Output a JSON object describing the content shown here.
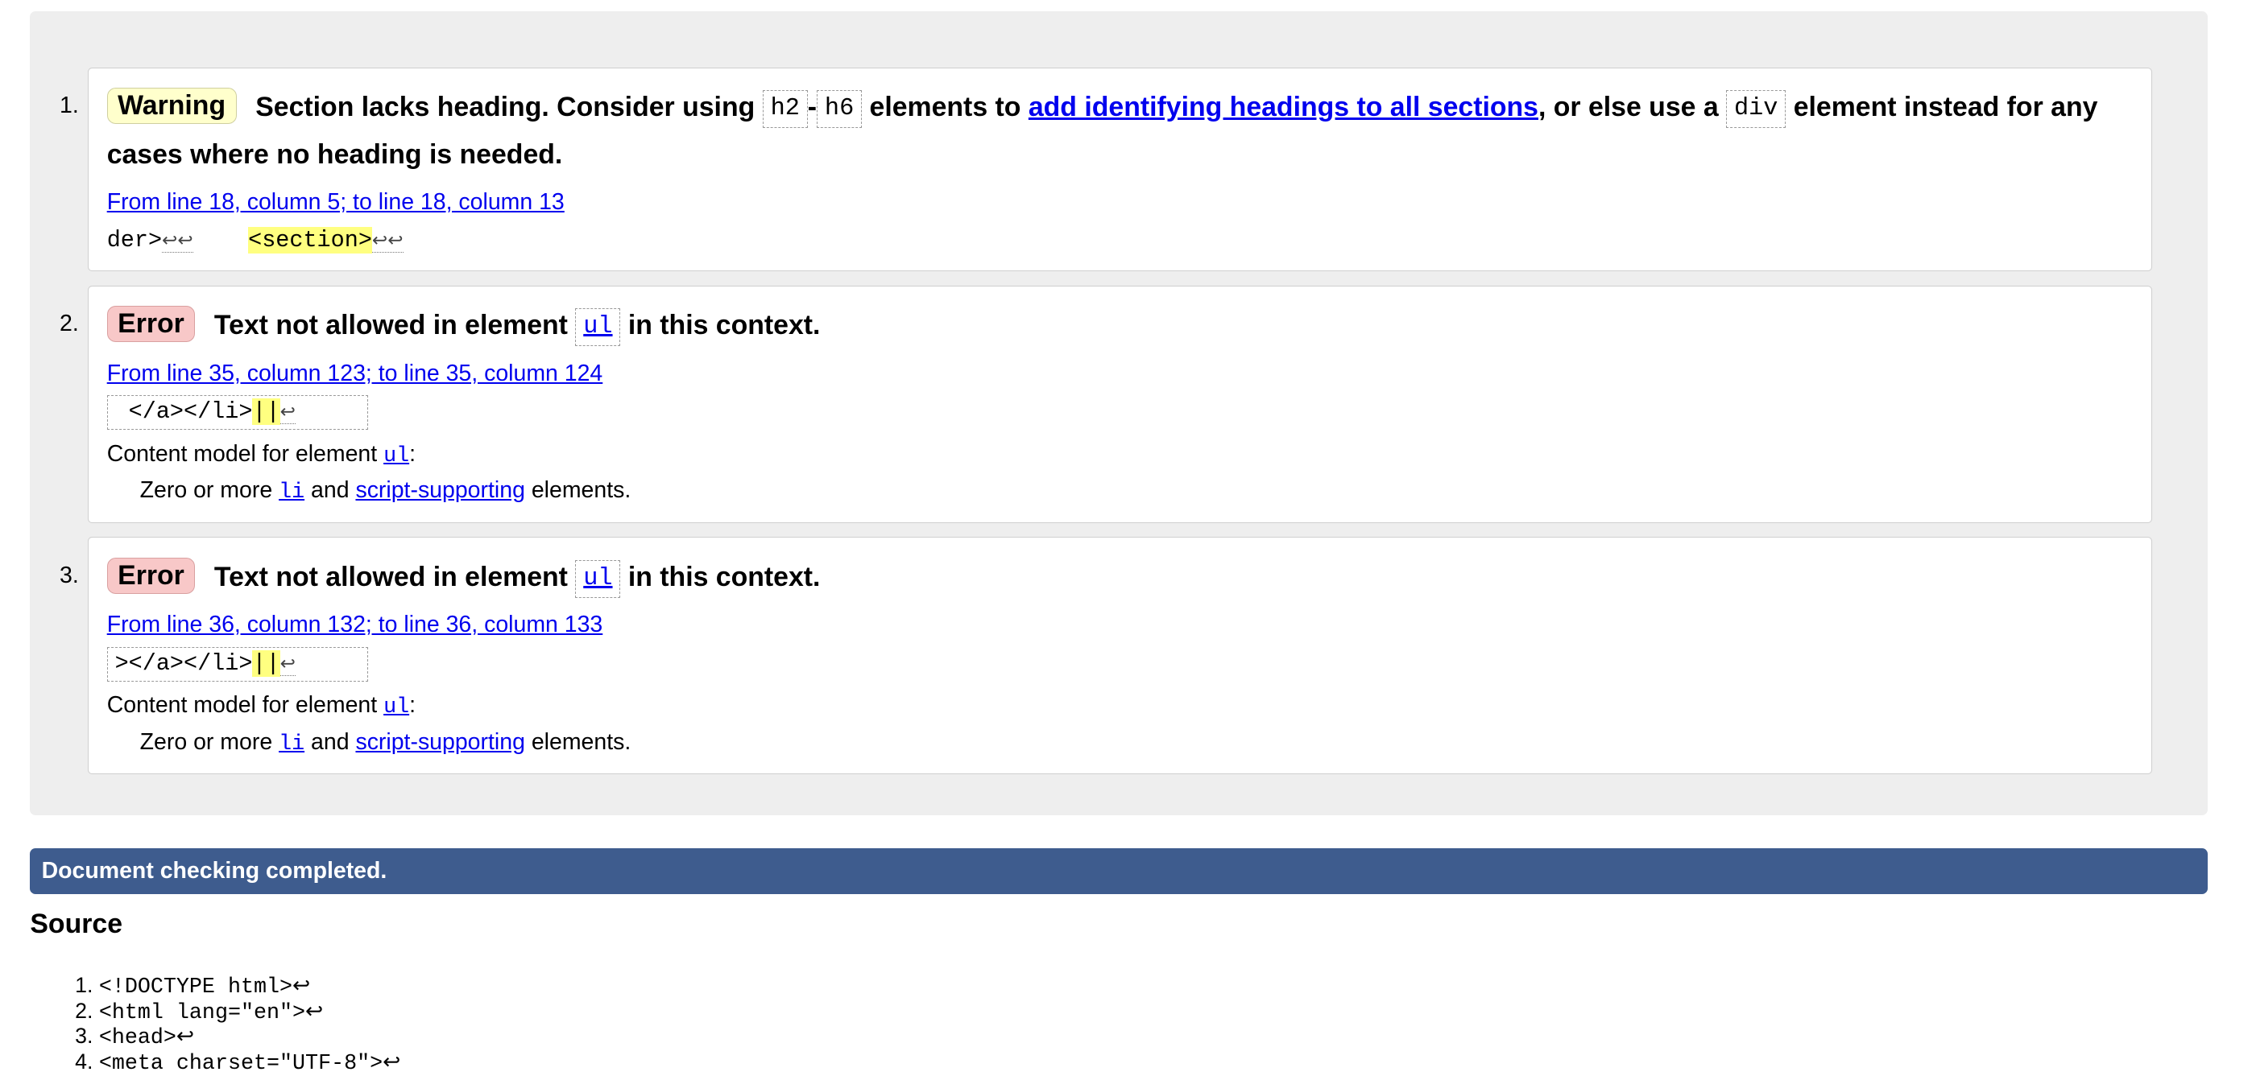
{
  "messages": [
    {
      "badge": "Warning",
      "text_1": "Section lacks heading. Consider using",
      "code_1": "h2",
      "dash": "-",
      "code_2": "h6",
      "text_2": "elements to",
      "link": "add identifying headings to all sections",
      "text_3": ", or else use a",
      "code_3": "div",
      "text_4": "element instead for any cases where no heading is needed.",
      "location": "From line 18, column 5; to line 18, column 13",
      "extract_pre": "der>",
      "extract_gap": "    ",
      "extract_hl": "<section>",
      "lf": "↩↩"
    },
    {
      "badge": "Error",
      "text_1": "Text not allowed in element",
      "code_1": "ul",
      "text_2": "in this context.",
      "location": "From line 35, column 123; to line 35, column 124",
      "extract_pre": " </a></li>",
      "extract_hl": "||",
      "lf": "↩",
      "cm_label": "Content model for element",
      "cm_code": "ul",
      "cm_colon": ":",
      "cm_body_1": "Zero or more",
      "cm_body_code": "li",
      "cm_body_2": "and",
      "cm_body_link": "script-supporting",
      "cm_body_3": "elements."
    },
    {
      "badge": "Error",
      "text_1": "Text not allowed in element",
      "code_1": "ul",
      "text_2": "in this context.",
      "location": "From line 36, column 132; to line 36, column 133",
      "extract_pre": "></a></li>",
      "extract_hl": "||",
      "lf": "↩",
      "cm_label": "Content model for element",
      "cm_code": "ul",
      "cm_colon": ":",
      "cm_body_1": "Zero or more",
      "cm_body_code": "li",
      "cm_body_2": "and",
      "cm_body_link": "script-supporting",
      "cm_body_3": "elements."
    }
  ],
  "status": "Document checking completed.",
  "source_heading": "Source",
  "source_lines": [
    "<!DOCTYPE html>↩",
    "<html lang=\"en\">↩",
    "<head>↩",
    "    <meta charset=\"UTF-8\">↩"
  ],
  "colors": {
    "status_bar": "#3e5c8e",
    "warning_badge": "#ffffcc",
    "error_badge": "#f8c8c8",
    "highlight": "#ffff80",
    "link": "#0000ee"
  }
}
